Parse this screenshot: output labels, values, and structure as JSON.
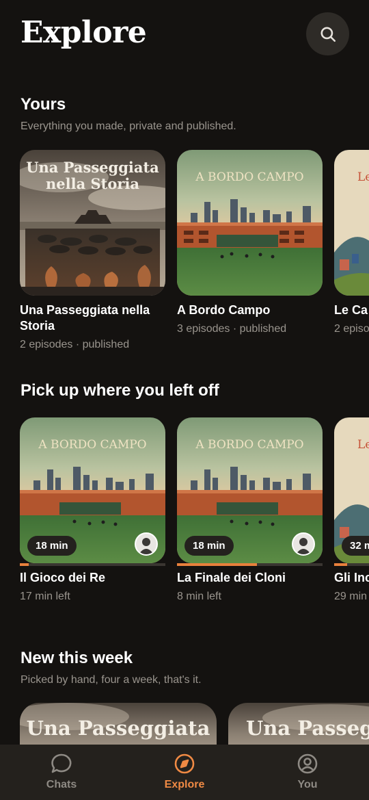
{
  "header": {
    "title": "Explore",
    "search_icon": "search-icon"
  },
  "colors": {
    "background": "#141210",
    "accent": "#f08a44",
    "muted_text": "#9a958e",
    "tab_bar": "#24211d"
  },
  "yours": {
    "title": "Yours",
    "subtitle": "Everything you made, private and published.",
    "items": [
      {
        "art_text": "Una Passeggiata nella Storia",
        "title": "Una Passeggiata nella Storia",
        "meta": "2 episodes · published"
      },
      {
        "art_text": "A BORDO CAMPO",
        "title": "A Bordo Campo",
        "meta": "3 episodes · published"
      },
      {
        "art_text": "Le",
        "title": "Le Ca",
        "meta": "2 episo"
      }
    ]
  },
  "continue": {
    "title": "Pick up where you left off",
    "items": [
      {
        "art_text": "A BORDO CAMPO",
        "duration": "18 min",
        "title": "Il Gioco dei Re",
        "meta": "17 min left",
        "progress": 0.06
      },
      {
        "art_text": "A BORDO CAMPO",
        "duration": "18 min",
        "title": "La Finale dei Cloni",
        "meta": "8 min left",
        "progress": 0.55
      },
      {
        "art_text": "Le",
        "duration": "32 m",
        "title": "Gli Inc",
        "meta": "29 min",
        "progress": 0.09
      }
    ]
  },
  "new_week": {
    "title": "New this week",
    "subtitle": "Picked by hand, four a week, that's it.",
    "items": [
      {
        "art_text": "Una Passeggiata"
      },
      {
        "art_text": "Una Passegg"
      }
    ]
  },
  "tabs": [
    {
      "label": "Chats",
      "icon": "chat-bubble-icon",
      "active": false
    },
    {
      "label": "Explore",
      "icon": "compass-icon",
      "active": true
    },
    {
      "label": "You",
      "icon": "user-circle-icon",
      "active": false
    }
  ]
}
